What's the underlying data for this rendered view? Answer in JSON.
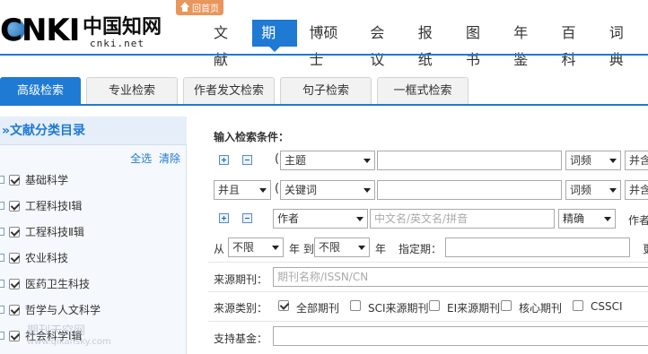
{
  "header": {
    "logo_text": "CNKI",
    "logo_cn": "中国知网",
    "logo_url": "cnki.net",
    "home_label": "回首页",
    "nav": [
      {
        "label": "文献",
        "active": false
      },
      {
        "label": "期刊",
        "active": true
      },
      {
        "label": "博硕士",
        "active": false
      },
      {
        "label": "会议",
        "active": false
      },
      {
        "label": "报纸",
        "active": false
      },
      {
        "label": "图书",
        "active": false
      },
      {
        "label": "年鉴",
        "active": false
      },
      {
        "label": "百科",
        "active": false
      },
      {
        "label": "词典",
        "active": false
      }
    ]
  },
  "tabs": [
    {
      "label": "高级检索",
      "active": true
    },
    {
      "label": "专业检索",
      "active": false
    },
    {
      "label": "作者发文检索",
      "active": false
    },
    {
      "label": "句子检索",
      "active": false
    },
    {
      "label": "一框式检索",
      "active": false
    }
  ],
  "sidebar": {
    "title": "»文献分类目录",
    "select_all": "全选",
    "clear": "清除",
    "items": [
      {
        "label": "基础科学",
        "checked": true
      },
      {
        "label": "工程科技Ⅰ辑",
        "checked": true
      },
      {
        "label": "工程科技Ⅱ辑",
        "checked": true
      },
      {
        "label": "农业科技",
        "checked": true
      },
      {
        "label": "医药卫生科技",
        "checked": true
      },
      {
        "label": "哲学与人文科学",
        "checked": true
      },
      {
        "label": "社会科学Ⅰ辑",
        "checked": true
      }
    ],
    "watermark": "期刊天空网",
    "watermark_url": "www.qikansky.com"
  },
  "form": {
    "section_title": "输入检索条件：",
    "paren": "(",
    "row1": {
      "field": "主题",
      "freq": "词频",
      "combine": "并含"
    },
    "row2": {
      "logic": "并且",
      "field": "关键词",
      "freq": "词频",
      "combine": "并含"
    },
    "row3": {
      "field": "作者",
      "placeholder": "中文名/英文名/拼音",
      "match": "精确",
      "right_label": "作者"
    },
    "row4": {
      "from_label": "从",
      "from_value": "不限",
      "year_to": "年 到",
      "to_value": "不限",
      "year": "年",
      "period_label": "指定期：",
      "right_label": "更"
    },
    "row5": {
      "label": "来源期刊：",
      "placeholder": "期刊名称/ISSN/CN"
    },
    "row6": {
      "label": "来源类别：",
      "options": [
        {
          "label": "全部期刊",
          "checked": true
        },
        {
          "label": "SCI来源期刊",
          "checked": false
        },
        {
          "label": "EI来源期刊",
          "checked": false
        },
        {
          "label": "核心期刊",
          "checked": false
        },
        {
          "label": "CSSCI",
          "checked": false
        }
      ]
    },
    "row7": {
      "label": "支持基金："
    }
  }
}
